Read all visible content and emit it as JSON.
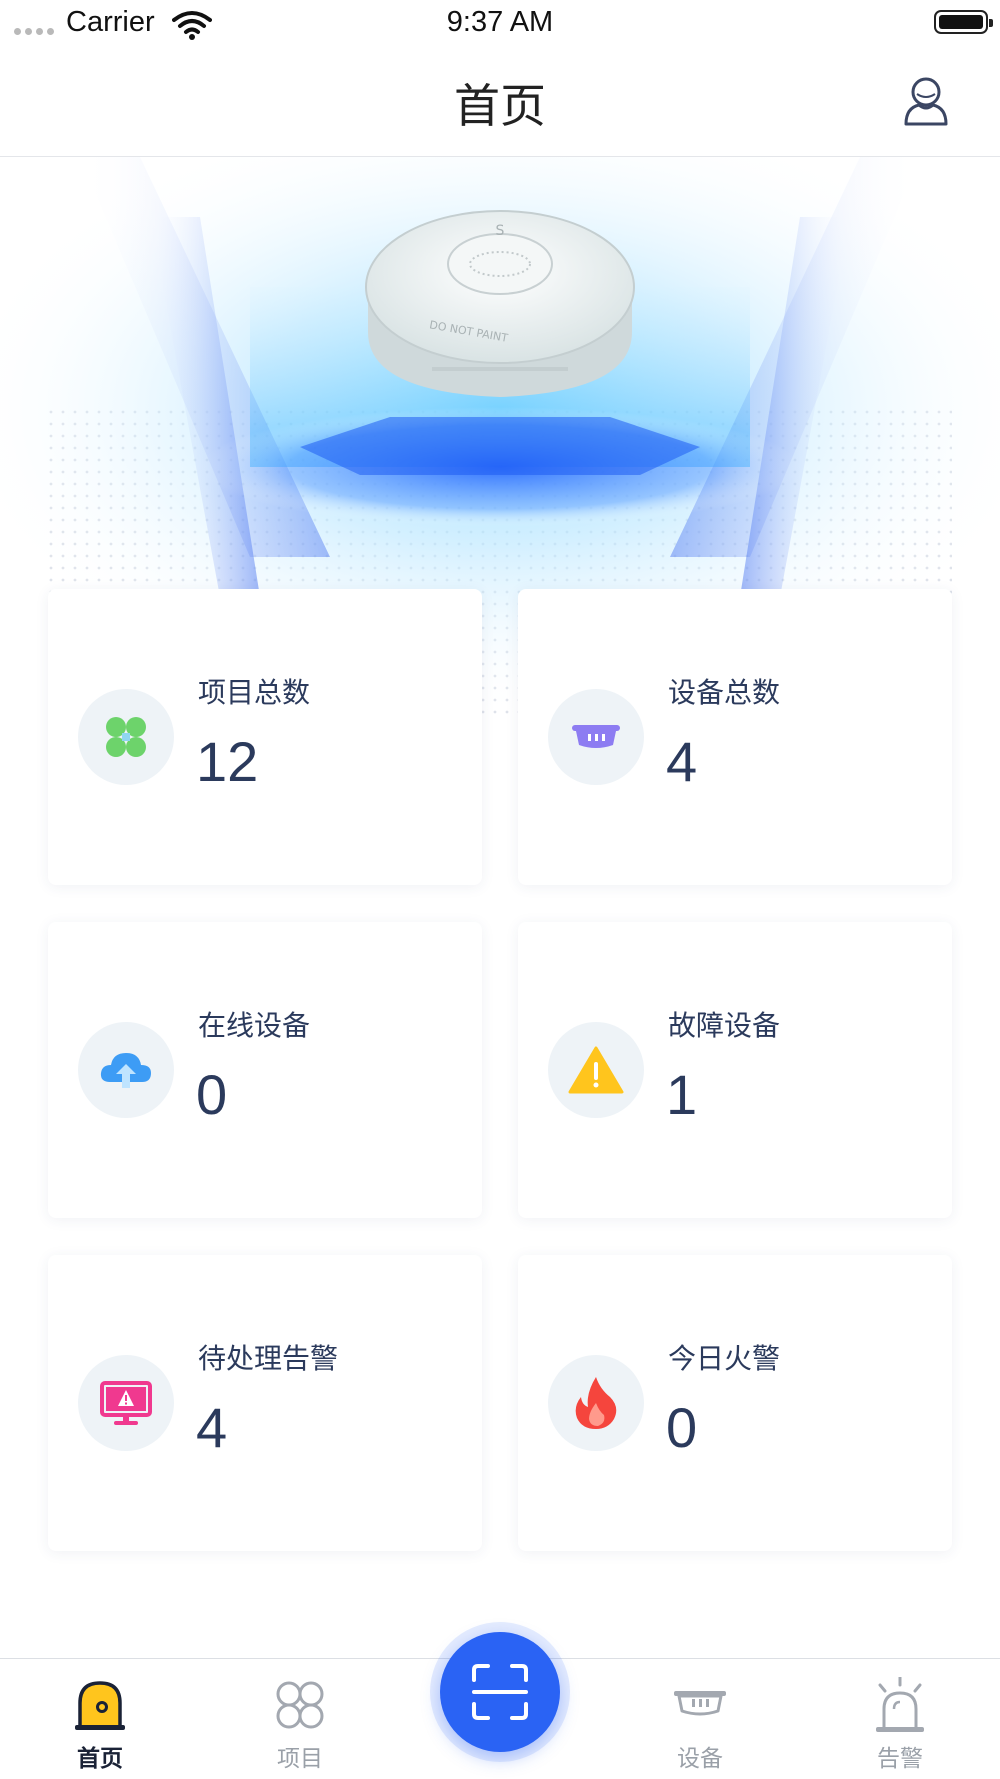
{
  "status_bar": {
    "carrier": "Carrier",
    "time": "9:37 AM"
  },
  "nav": {
    "title": "首页",
    "user_icon": "user-icon"
  },
  "hero": {
    "device_text": "DO NOT PAINT",
    "device_mark": "S"
  },
  "cards": [
    {
      "label": "项目总数",
      "value": "12",
      "icon": "grid-clover-icon",
      "color": "#6dd36b"
    },
    {
      "label": "设备总数",
      "value": "4",
      "icon": "smoke-detector-icon",
      "color": "#8d7cf2"
    },
    {
      "label": "在线设备",
      "value": "0",
      "icon": "cloud-upload-icon",
      "color": "#3d9cf5"
    },
    {
      "label": "故障设备",
      "value": "1",
      "icon": "warning-icon",
      "color": "#ffc51d"
    },
    {
      "label": "待处理告警",
      "value": "4",
      "icon": "monitor-alert-icon",
      "color": "#f0398f"
    },
    {
      "label": "今日火警",
      "value": "0",
      "icon": "fire-icon",
      "color": "#f5453d"
    }
  ],
  "tab_bar": {
    "tabs": [
      {
        "label": "首页",
        "icon": "home-alarm-icon",
        "active": true
      },
      {
        "label": "项目",
        "icon": "clover-icon",
        "active": false
      },
      {
        "label": "设备",
        "icon": "device-icon",
        "active": false
      },
      {
        "label": "告警",
        "icon": "alarm-light-icon",
        "active": false
      }
    ],
    "scan_icon": "scan-icon",
    "accent": "#2a63f4"
  }
}
